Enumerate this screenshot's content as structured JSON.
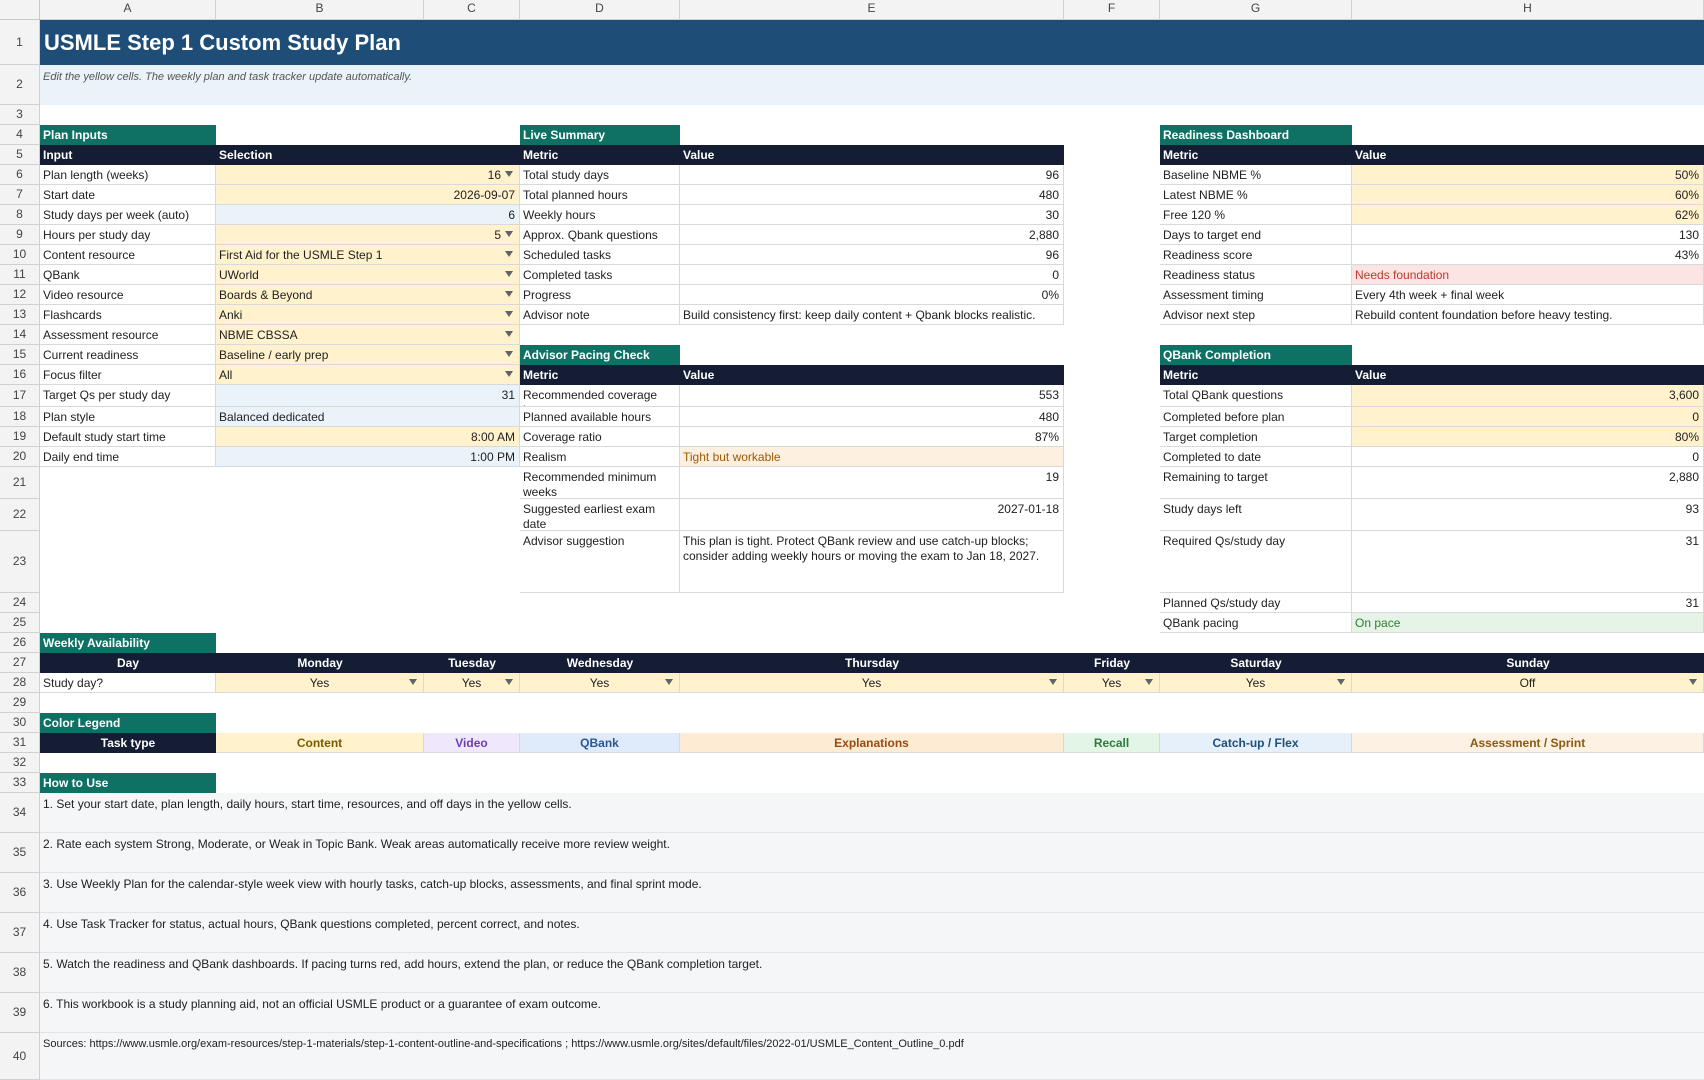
{
  "columns": [
    "A",
    "B",
    "C",
    "D",
    "E",
    "F",
    "G",
    "H"
  ],
  "rows": [
    "1",
    "2",
    "3",
    "4",
    "5",
    "6",
    "7",
    "8",
    "9",
    "10",
    "11",
    "12",
    "13",
    "14",
    "15",
    "16",
    "17",
    "18",
    "19",
    "20",
    "21",
    "22",
    "23",
    "24",
    "25",
    "26",
    "27",
    "28",
    "29",
    "30",
    "31",
    "32",
    "33",
    "34",
    "35",
    "36",
    "37",
    "38",
    "39",
    "40"
  ],
  "title": "USMLE Step 1 Custom Study Plan",
  "subtitle": "Edit the yellow cells. The weekly plan and task tracker update automatically.",
  "plan_inputs": {
    "title": "Plan Inputs",
    "header": [
      "Input",
      "Selection"
    ],
    "rows": [
      {
        "label": "Plan length (weeks)",
        "value": "16"
      },
      {
        "label": "Start date",
        "value": "2026-09-07"
      },
      {
        "label": "Study days per week (auto)",
        "value": "6"
      },
      {
        "label": "Hours per study day",
        "value": "5"
      },
      {
        "label": "Content resource",
        "value": "First Aid for the USMLE Step 1"
      },
      {
        "label": "QBank",
        "value": "UWorld"
      },
      {
        "label": "Video resource",
        "value": "Boards & Beyond"
      },
      {
        "label": "Flashcards",
        "value": "Anki"
      },
      {
        "label": "Assessment resource",
        "value": "NBME CBSSA"
      },
      {
        "label": "Current readiness",
        "value": "Baseline / early prep"
      },
      {
        "label": "Focus filter",
        "value": "All"
      },
      {
        "label": "Target Qs per study day",
        "value": "31"
      },
      {
        "label": "Plan style",
        "value": "Balanced dedicated"
      },
      {
        "label": "Default study start time",
        "value": "8:00 AM"
      },
      {
        "label": "Daily end time",
        "value": "1:00 PM"
      }
    ]
  },
  "live_summary": {
    "title": "Live Summary",
    "header": [
      "Metric",
      "Value"
    ],
    "rows": [
      {
        "label": "Total study days",
        "value": "96"
      },
      {
        "label": "Total planned hours",
        "value": "480"
      },
      {
        "label": "Weekly hours",
        "value": "30"
      },
      {
        "label": "Approx. Qbank questions",
        "value": "2,880"
      },
      {
        "label": "Scheduled tasks",
        "value": "96"
      },
      {
        "label": "Completed tasks",
        "value": "0"
      },
      {
        "label": "Progress",
        "value": "0%"
      },
      {
        "label": "Advisor note",
        "value": "Build consistency first: keep daily content + Qbank blocks realistic."
      }
    ]
  },
  "advisor_pacing": {
    "title": "Advisor Pacing Check",
    "header": [
      "Metric",
      "Value"
    ],
    "rows": [
      {
        "label": "Recommended coverage hours",
        "value": "553"
      },
      {
        "label": "Planned available hours",
        "value": "480"
      },
      {
        "label": "Coverage ratio",
        "value": "87%"
      },
      {
        "label": "Realism",
        "value": "Tight but workable"
      },
      {
        "label": "Recommended minimum weeks",
        "value": "19"
      },
      {
        "label": "Suggested earliest exam date",
        "value": "2027-01-18"
      },
      {
        "label": "Advisor suggestion",
        "value": "This plan is tight. Protect QBank review and use catch-up blocks; consider adding weekly hours or moving the exam to Jan 18, 2027."
      }
    ]
  },
  "readiness": {
    "title": "Readiness Dashboard",
    "header": [
      "Metric",
      "Value"
    ],
    "rows": [
      {
        "label": "Baseline NBME %",
        "value": "50%"
      },
      {
        "label": "Latest NBME %",
        "value": "60%"
      },
      {
        "label": "Free 120 %",
        "value": "62%"
      },
      {
        "label": "Days to target end",
        "value": "130"
      },
      {
        "label": "Readiness score",
        "value": "43%"
      },
      {
        "label": "Readiness status",
        "value": "Needs foundation"
      },
      {
        "label": "Assessment timing",
        "value": "Every 4th week + final week"
      },
      {
        "label": "Advisor next step",
        "value": "Rebuild content foundation before heavy testing."
      }
    ]
  },
  "qbank": {
    "title": "QBank Completion",
    "header": [
      "Metric",
      "Value"
    ],
    "rows": [
      {
        "label": "Total QBank questions",
        "value": "3,600"
      },
      {
        "label": "Completed before plan",
        "value": "0"
      },
      {
        "label": "Target completion",
        "value": "80%"
      },
      {
        "label": "Completed to date",
        "value": "0"
      },
      {
        "label": "Remaining to target",
        "value": "2,880"
      },
      {
        "label": "Study days left",
        "value": "93"
      },
      {
        "label": "Required Qs/study day",
        "value": "31"
      },
      {
        "label": "Planned Qs/study day",
        "value": "31"
      },
      {
        "label": "QBank pacing",
        "value": "On pace"
      }
    ]
  },
  "weekly": {
    "title": "Weekly Availability",
    "day_label": "Day",
    "days": [
      "Monday",
      "Tuesday",
      "Wednesday",
      "Thursday",
      "Friday",
      "Saturday",
      "Sunday"
    ],
    "row_label": "Study day?",
    "values": [
      "Yes",
      "Yes",
      "Yes",
      "Yes",
      "Yes",
      "Yes",
      "Off"
    ]
  },
  "legend": {
    "title": "Color Legend",
    "label": "Task type",
    "items": [
      {
        "name": "Content",
        "bg": "#fff2cc",
        "fg": "#7a5a00"
      },
      {
        "name": "Video",
        "bg": "#efe7fb",
        "fg": "#6a3fb5"
      },
      {
        "name": "QBank",
        "bg": "#dfeafa",
        "fg": "#2b5797"
      },
      {
        "name": "Explanations",
        "bg": "#fdebd3",
        "fg": "#9a4a12"
      },
      {
        "name": "Recall",
        "bg": "#e2f5e6",
        "fg": "#2f7a3f"
      },
      {
        "name": "Catch-up / Flex",
        "bg": "#e6f0fa",
        "fg": "#1f4e79"
      },
      {
        "name": "Assessment / Sprint",
        "bg": "#fdf1e4",
        "fg": "#8a5a12"
      }
    ]
  },
  "howto": {
    "title": "How to Use",
    "items": [
      "1. Set your start date, plan length, daily hours, start time, resources, and off days in the yellow cells.",
      "2. Rate each system Strong, Moderate, or Weak in Topic Bank. Weak areas automatically receive more review weight.",
      "3. Use Weekly Plan for the calendar-style week view with hourly tasks, catch-up blocks, assessments, and final sprint mode.",
      "4. Use Task Tracker for status, actual hours, QBank questions completed, percent correct, and notes.",
      "5. Watch the readiness and QBank dashboards. If pacing turns red, add hours, extend the plan, or reduce the QBank completion target.",
      "6. This workbook is a study planning aid, not an official USMLE product or a guarantee of exam outcome."
    ],
    "sources": "Sources: https://www.usmle.org/exam-resources/step-1-materials/step-1-content-outline-and-specifications ; https://www.usmle.org/sites/default/files/2022-01/USMLE_Content_Outline_0.pdf"
  }
}
